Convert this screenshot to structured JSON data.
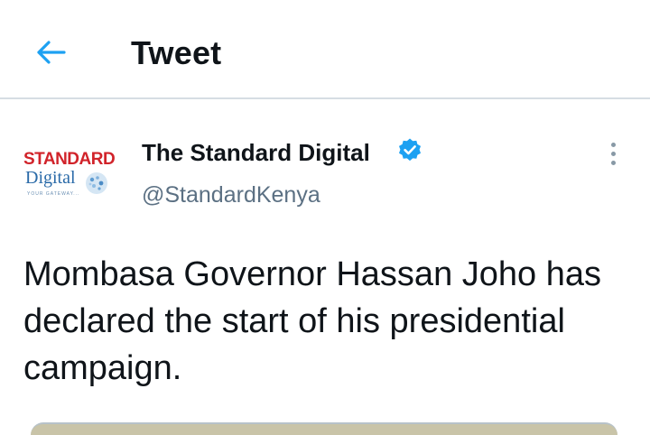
{
  "header": {
    "back_icon": "arrow-left-icon",
    "title": "Tweet",
    "accent_color": "#1da1f2"
  },
  "tweet": {
    "avatar": {
      "logo_top": "STANDARD",
      "logo_bottom": "Digital",
      "logo_tagline": "YOUR GATEWAY..."
    },
    "display_name": "The Standard Digital",
    "verified_icon": "verified-badge-icon",
    "handle": "@StandardKenya",
    "more_icon": "more-vertical-icon",
    "text": "Mombasa Governor Hassan Joho has declared the start of his presidential campaign."
  }
}
